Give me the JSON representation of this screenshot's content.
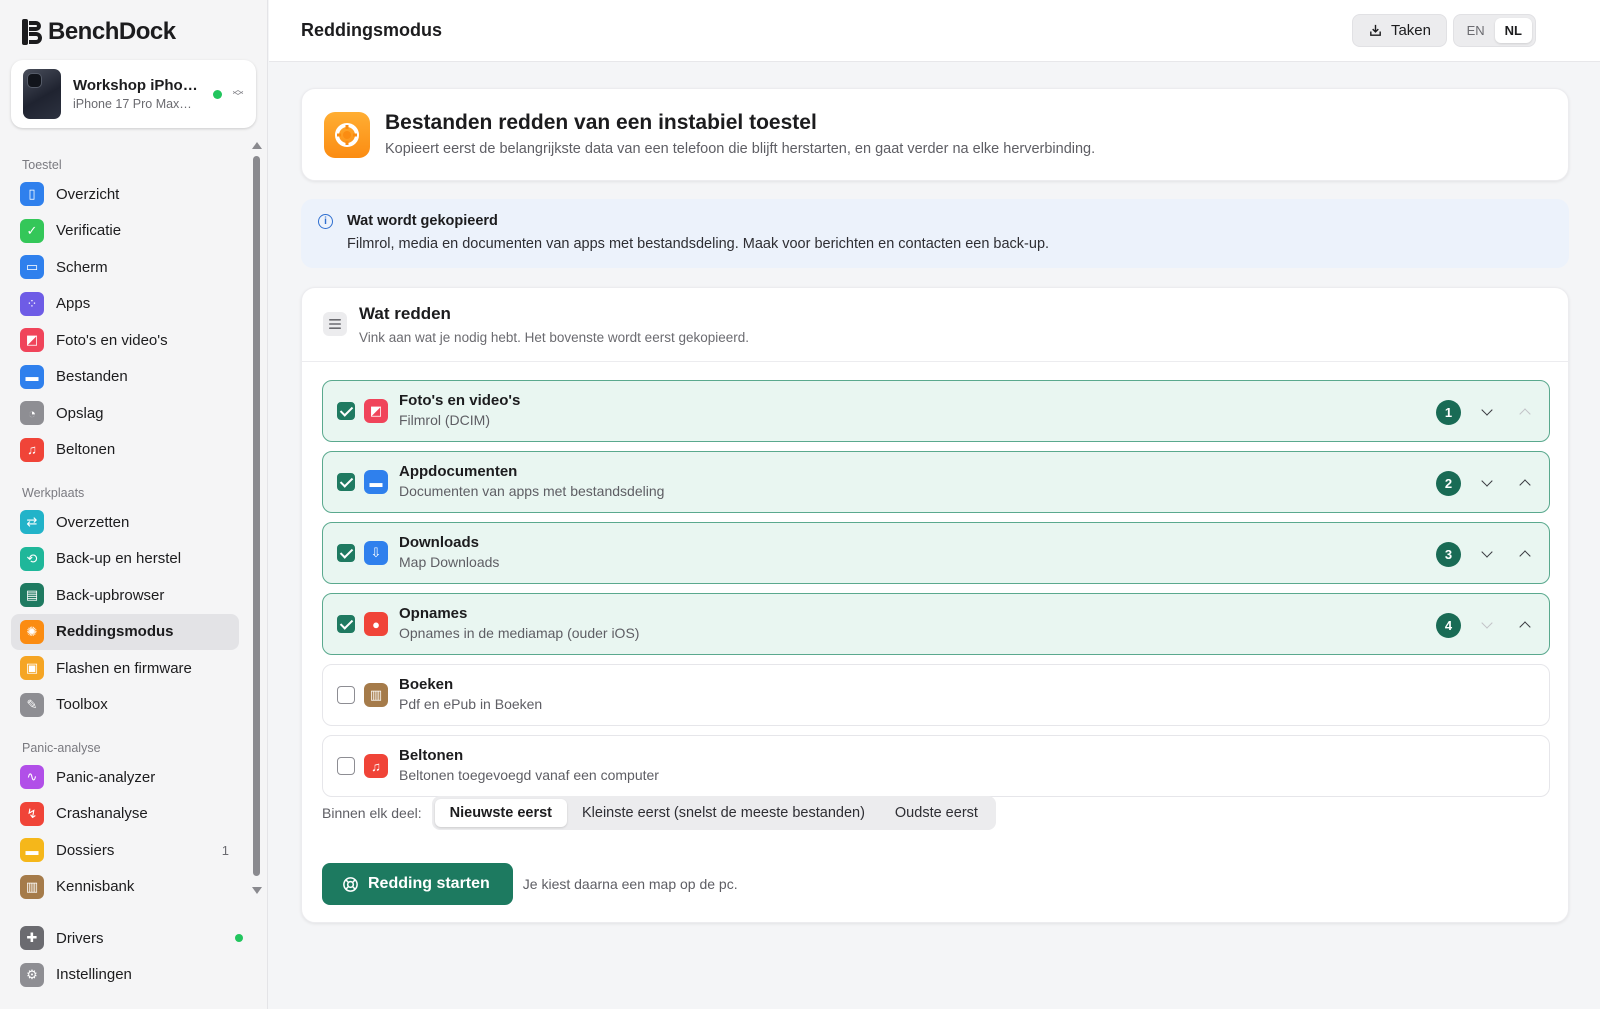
{
  "app": {
    "name_part1": "Bench",
    "name_part2": "Dock"
  },
  "device": {
    "name": "Workshop iPho…",
    "model": "iPhone 17 Pro Max…",
    "status_color": "#22c55e"
  },
  "sidebar": {
    "sections": [
      {
        "label": "Toestel",
        "items": [
          {
            "label": "Overzicht",
            "icon": "phone-icon",
            "color": "#2f80ed"
          },
          {
            "label": "Verificatie",
            "icon": "shield-check-icon",
            "color": "#34c759"
          },
          {
            "label": "Scherm",
            "icon": "screen-icon",
            "color": "#2f80ed"
          },
          {
            "label": "Apps",
            "icon": "apps-grid-icon",
            "color": "#6e5ce6"
          },
          {
            "label": "Foto's en video's",
            "icon": "photos-icon",
            "color": "#f0445a"
          },
          {
            "label": "Bestanden",
            "icon": "folder-icon",
            "color": "#2f80ed"
          },
          {
            "label": "Opslag",
            "icon": "storage-pie-icon",
            "color": "#8e8e93"
          },
          {
            "label": "Beltonen",
            "icon": "music-note-icon",
            "color": "#f04438"
          }
        ]
      },
      {
        "label": "Werkplaats",
        "items": [
          {
            "label": "Overzetten",
            "icon": "transfer-arrows-icon",
            "color": "#22b3c9"
          },
          {
            "label": "Back-up en herstel",
            "icon": "backup-restore-icon",
            "color": "#1fb79a"
          },
          {
            "label": "Back-upbrowser",
            "icon": "archive-browser-icon",
            "color": "#1f7a61"
          },
          {
            "label": "Reddingsmodus",
            "icon": "lifebuoy-icon",
            "color": "#fb8c12",
            "active": true
          },
          {
            "label": "Flashen en firmware",
            "icon": "firmware-chip-icon",
            "color": "#f5a524"
          },
          {
            "label": "Toolbox",
            "icon": "wrench-icon",
            "color": "#8e8e93"
          }
        ]
      },
      {
        "label": "Panic-analyse",
        "items": [
          {
            "label": "Panic-analyzer",
            "icon": "pulse-icon",
            "color": "#b14fe8"
          },
          {
            "label": "Crashanalyse",
            "icon": "crash-graph-icon",
            "color": "#f04438"
          },
          {
            "label": "Dossiers",
            "icon": "folder-icon",
            "color": "#f5b71a",
            "badge": "1"
          },
          {
            "label": "Kennisbank",
            "icon": "book-icon",
            "color": "#a57b4a"
          }
        ]
      }
    ],
    "footer": [
      {
        "label": "Drivers",
        "icon": "puzzle-icon",
        "color": "#6b6b70",
        "status_color": "#22c55e"
      },
      {
        "label": "Instellingen",
        "icon": "gear-icon",
        "color": "#8e8e93"
      }
    ]
  },
  "topbar": {
    "title": "Reddingsmodus",
    "tasks_label": "Taken",
    "lang_en": "EN",
    "lang_nl": "NL",
    "lang_active": "NL"
  },
  "hero": {
    "title": "Bestanden redden van een instabiel toestel",
    "subtitle": "Kopieert eerst de belangrijkste data van een telefoon die blijft herstarten, en gaat verder na elke herverbinding."
  },
  "info": {
    "title": "Wat wordt gekopieerd",
    "text": "Filmrol, media en documenten van apps met bestandsdeling. Maak voor berichten en contacten een back-up."
  },
  "panel": {
    "title": "Wat redden",
    "subtitle": "Vink aan wat je nodig hebt. Het bovenste wordt eerst gekopieerd.",
    "items": [
      {
        "title": "Foto's en video's",
        "subtitle": "Filmrol (DCIM)",
        "checked": true,
        "order": "1",
        "icon": "photos-icon",
        "color": "#f0445a"
      },
      {
        "title": "Appdocumenten",
        "subtitle": "Documenten van apps met bestandsdeling",
        "checked": true,
        "order": "2",
        "icon": "folder-icon",
        "color": "#2f80ed"
      },
      {
        "title": "Downloads",
        "subtitle": "Map Downloads",
        "checked": true,
        "order": "3",
        "icon": "download-box-icon",
        "color": "#2f80ed"
      },
      {
        "title": "Opnames",
        "subtitle": "Opnames in de mediamap (ouder iOS)",
        "checked": true,
        "order": "4",
        "icon": "microphone-icon",
        "color": "#f04438"
      },
      {
        "title": "Boeken",
        "subtitle": "Pdf en ePub in Boeken",
        "checked": false,
        "icon": "book-icon",
        "color": "#a57b4a"
      },
      {
        "title": "Beltonen",
        "subtitle": "Beltonen toegevoegd vanaf een computer",
        "checked": false,
        "icon": "music-note-icon",
        "color": "#f04438"
      }
    ],
    "order_label": "Binnen elk deel:",
    "order_options": [
      "Nieuwste eerst",
      "Kleinste eerst (snelst de meeste bestanden)",
      "Oudste eerst"
    ],
    "order_selected": "Nieuwste eerst",
    "start_label": "Redding starten",
    "start_hint": "Je kiest daarna een map op de pc.",
    "accent": "#1d7a60"
  }
}
